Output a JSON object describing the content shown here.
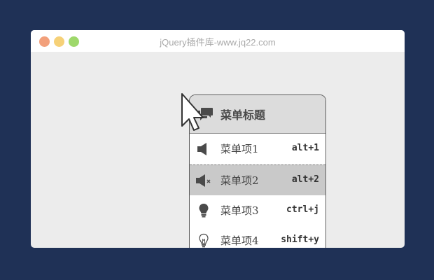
{
  "window": {
    "title": "jQuery插件库-www.jq22.com",
    "traffic_lights": [
      "#f2a07b",
      "#f6d178",
      "#9ed86b"
    ]
  },
  "menu": {
    "title": "菜单标题",
    "title_icon": "comments-icon",
    "items": [
      {
        "label": "菜单项1",
        "shortcut": "alt+1",
        "icon": "volume-icon",
        "selected": false
      },
      {
        "label": "菜单项2",
        "shortcut": "alt+2",
        "icon": "volume-mute-icon",
        "selected": true
      },
      {
        "label": "菜单项3",
        "shortcut": "ctrl+j",
        "icon": "lightbulb-filled-icon",
        "selected": false
      },
      {
        "label": "菜单项4",
        "shortcut": "shift+y",
        "icon": "lightbulb-outline-icon",
        "selected": false
      }
    ]
  },
  "colors": {
    "page_background": "#1f3156",
    "window_background": "#ececec",
    "menu_header": "#dcdcdc",
    "selected_item": "#c9c9c9"
  }
}
